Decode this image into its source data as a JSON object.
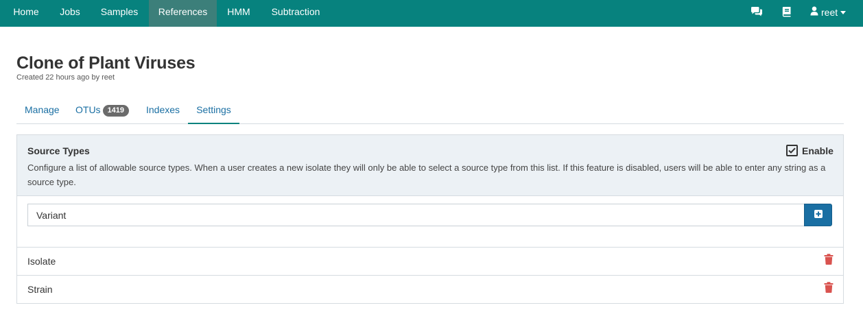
{
  "nav": {
    "items": [
      {
        "label": "Home"
      },
      {
        "label": "Jobs"
      },
      {
        "label": "Samples"
      },
      {
        "label": "References"
      },
      {
        "label": "HMM"
      },
      {
        "label": "Subtraction"
      }
    ],
    "active": "References",
    "icons": [
      "comments-icon",
      "book-icon"
    ],
    "user": "reet",
    "bar_color": "#07827e"
  },
  "header": {
    "title": "Clone of Plant Viruses",
    "subtitle": "Created 22 hours ago by reet"
  },
  "tabs": [
    {
      "label": "Manage"
    },
    {
      "label": "OTUs",
      "badge": "1419"
    },
    {
      "label": "Indexes"
    },
    {
      "label": "Settings"
    }
  ],
  "active_tab": "Settings",
  "source_types": {
    "title": "Source Types",
    "description": "Configure a list of allowable source types. When a user creates a new isolate they will only be able to select a source type from this list. If this feature is disabled, users will be able to enter any string as a source type.",
    "enable_label": "Enable",
    "enabled": true,
    "input_value": "Variant",
    "add_icon": "plus-square-icon",
    "items": [
      {
        "label": "Isolate"
      },
      {
        "label": "Strain"
      }
    ],
    "delete_icon": "trash-icon",
    "delete_color": "#d9534f"
  }
}
